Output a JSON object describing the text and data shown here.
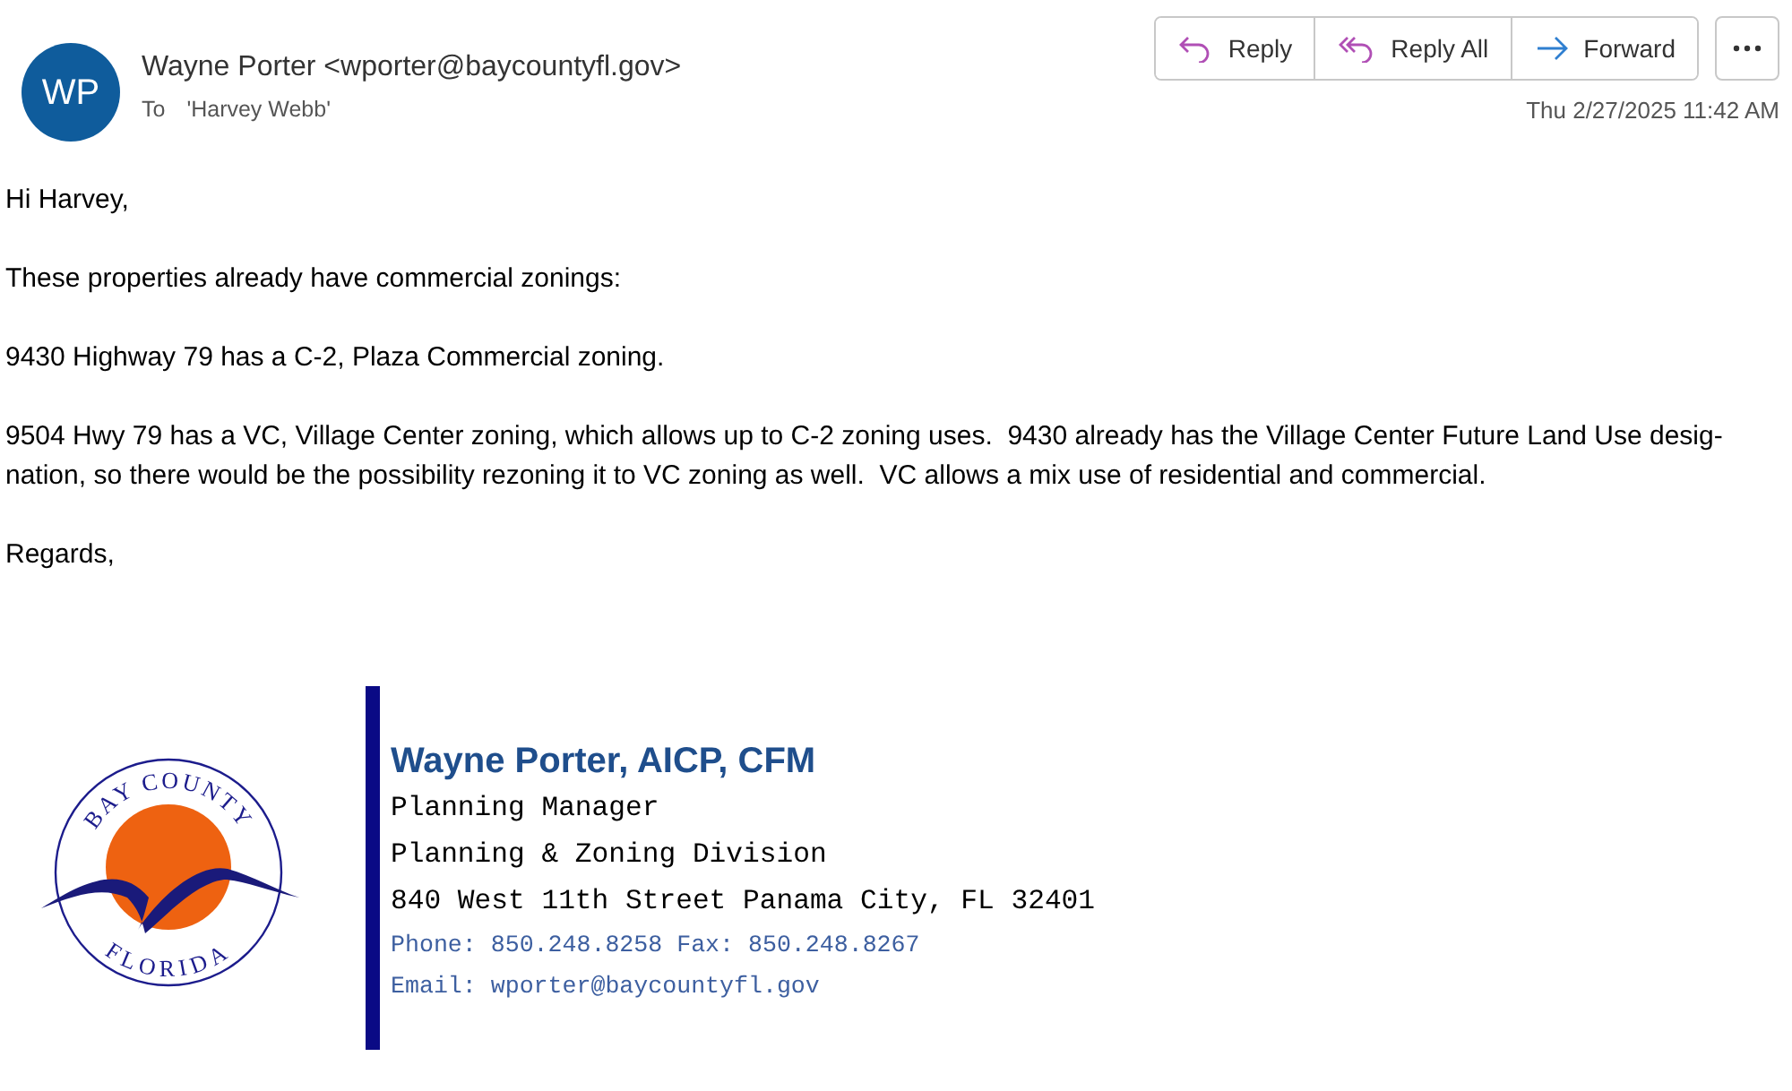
{
  "header": {
    "avatar_initials": "WP",
    "sender": "Wayne Porter <wporter@baycountyfl.gov>",
    "to_label": "To",
    "recipient": "'Harvey Webb'",
    "date": "Thu 2/27/2025 11:42 AM"
  },
  "actions": [
    {
      "kind": "reply",
      "label": "Reply"
    },
    {
      "kind": "reply_all",
      "label": "Reply All"
    },
    {
      "kind": "forward",
      "label": "Forward"
    }
  ],
  "body": [
    {
      "lines": [
        "Hi Harvey,"
      ]
    },
    {
      "lines": [
        "These properties already have commercial zonings:"
      ]
    },
    {
      "lines": [
        "9430 Highway 79 has a C-2, Plaza Commercial zoning."
      ]
    },
    {
      "lines": [
        "9504 Hwy 79 has a VC, Village Center zoning, which allows up to C-2 zoning uses.  9430 already has the Village Center Future Land Use desig-",
        "nation, so there would be the possibility rezoning it to VC zoning as well.  VC allows a mix use of residential and commercial."
      ]
    },
    {
      "lines": [
        "Regards,"
      ]
    }
  ],
  "signature": {
    "logo": {
      "top_text": "BAY COUNTY",
      "bottom_text": "FLORIDA"
    },
    "name": "Wayne Porter, AICP, CFM",
    "lines": [
      {
        "kind": "plain",
        "text": "Planning Manager"
      },
      {
        "kind": "plain",
        "text": "Planning & Zoning Division"
      },
      {
        "kind": "plain",
        "text": "840 West 11th Street Panama City, FL 32401"
      },
      {
        "kind": "contact",
        "text": "Phone: 850.248.8258 Fax: 850.248.8267"
      },
      {
        "kind": "contact",
        "text": "Email: wporter@baycountyfl.gov"
      }
    ]
  }
}
